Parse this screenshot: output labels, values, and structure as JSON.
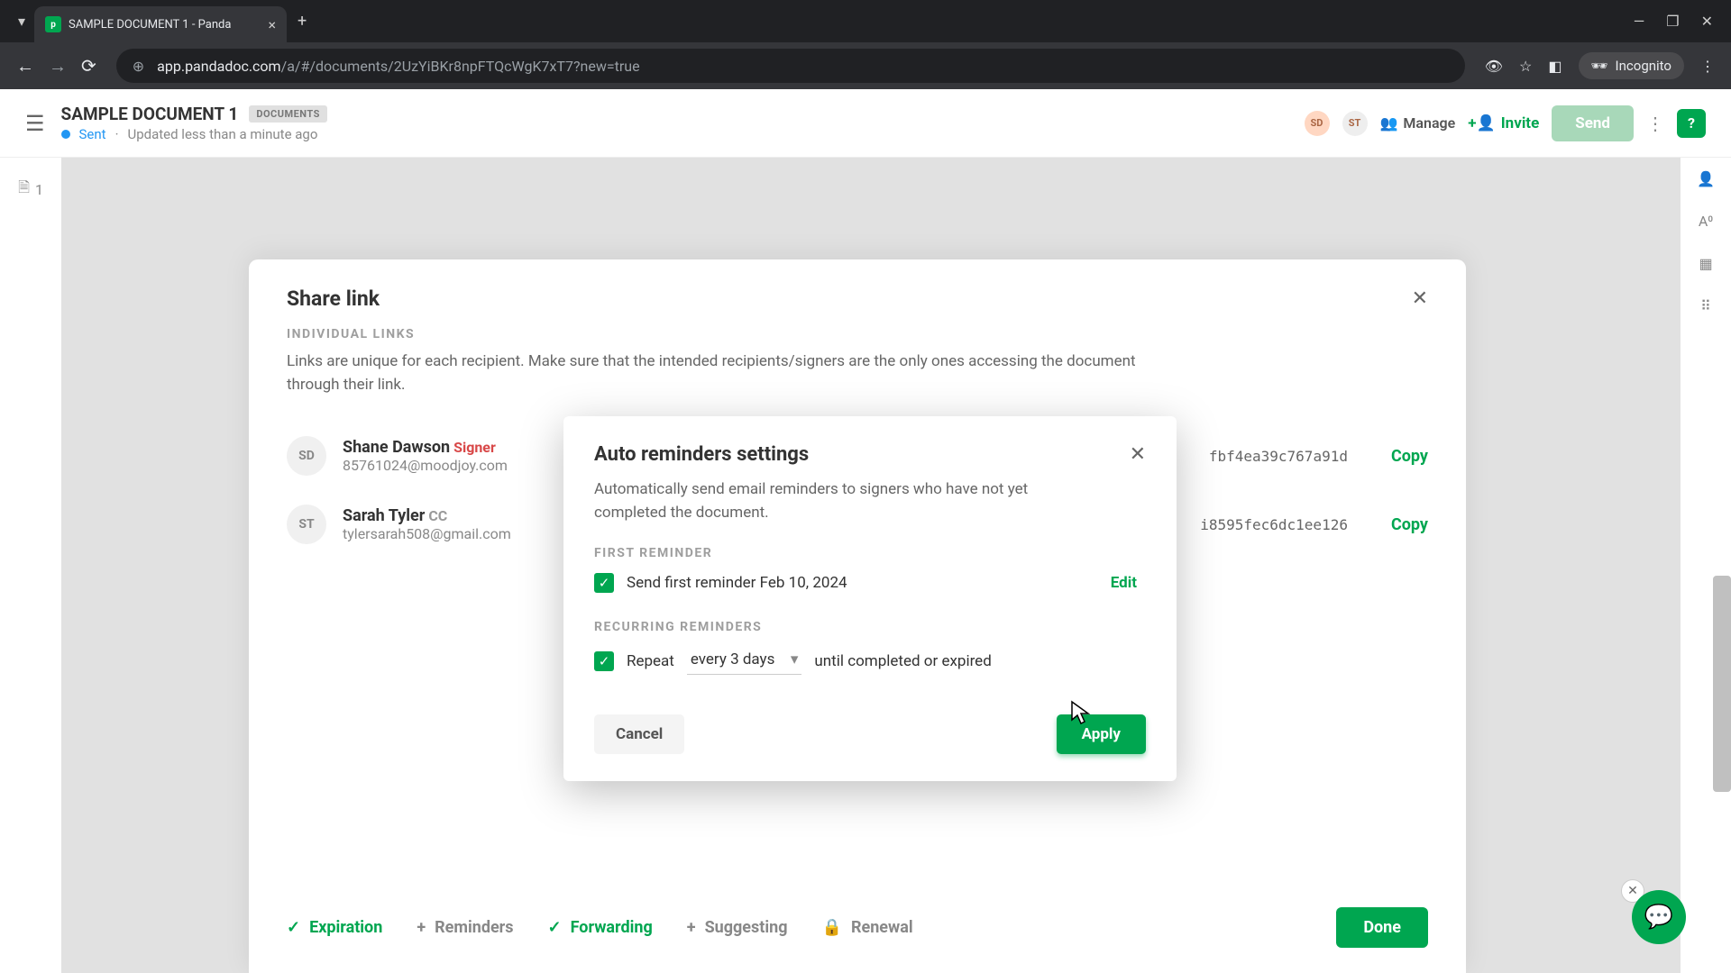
{
  "browser": {
    "tab_title": "SAMPLE DOCUMENT 1 - Panda",
    "url_domain": "app.pandadoc.com",
    "url_path": "/a/#/documents/2UzYiBKr8npFTQcWgK7xT7?new=true",
    "incognito_label": "Incognito"
  },
  "header": {
    "doc_title": "SAMPLE DOCUMENT 1",
    "doc_badge": "DOCUMENTS",
    "status": "Sent",
    "status_meta": "Updated less than a minute ago",
    "avatars": [
      "SD",
      "ST"
    ],
    "manage": "Manage",
    "invite": "Invite",
    "send": "Send"
  },
  "left_rail": {
    "doc_count": "1"
  },
  "share": {
    "title": "Share link",
    "label": "INDIVIDUAL LINKS",
    "desc": "Links are unique for each recipient. Make sure that the intended recipients/signers are the only ones accessing the document through their link.",
    "people": [
      {
        "initials": "SD",
        "name": "Shane Dawson",
        "role": "Signer",
        "role_kind": "signer",
        "email": "85761024@moodjoy.com",
        "link_frag": "fbf4ea39c767a91d",
        "copy": "Copy"
      },
      {
        "initials": "ST",
        "name": "Sarah Tyler",
        "role": "CC",
        "role_kind": "cc",
        "email": "tylersarah508@gmail.com",
        "link_frag": "i8595fec6dc1ee126",
        "copy": "Copy"
      }
    ],
    "bottom": {
      "expiration": "Expiration",
      "reminders": "Reminders",
      "forwarding": "Forwarding",
      "suggesting": "Suggesting",
      "renewal": "Renewal",
      "done": "Done"
    }
  },
  "modal": {
    "title": "Auto reminders settings",
    "desc": "Automatically send email reminders to signers who have not yet completed the document.",
    "first_label": "FIRST REMINDER",
    "first_text": "Send first reminder Feb 10, 2024",
    "edit": "Edit",
    "recurring_label": "RECURRING REMINDERS",
    "repeat_label": "Repeat",
    "repeat_value": "every 3 days",
    "repeat_suffix": "until completed or expired",
    "cancel": "Cancel",
    "apply": "Apply"
  }
}
